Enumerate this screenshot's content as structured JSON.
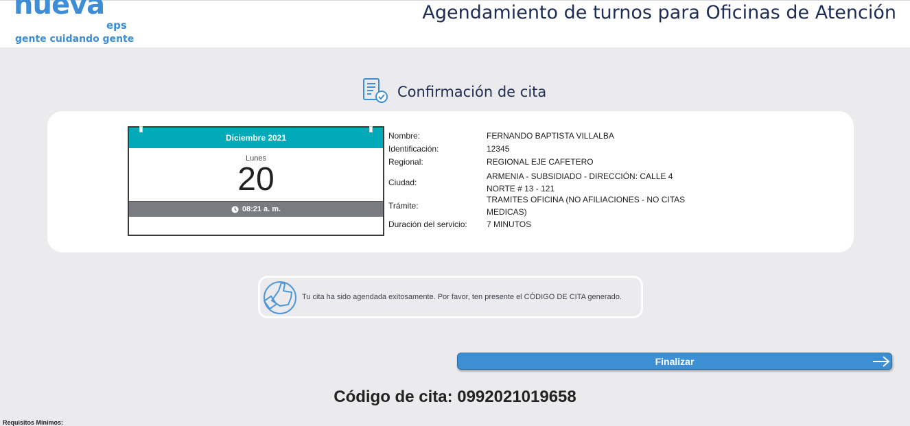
{
  "header": {
    "logo_word": "nueva",
    "logo_sub": "eps",
    "logo_tagline": "gente cuidando gente",
    "title": "Agendamiento de turnos para Oficinas de Atención"
  },
  "section": {
    "title": "Confirmación de cita",
    "icon": "document-check-icon"
  },
  "calendar": {
    "month": "Diciembre 2021",
    "weekday": "Lunes",
    "day": "20",
    "time": "08:21 a. m.",
    "header_color": "#00aab8"
  },
  "details": {
    "name_label": "Nombre:",
    "name_value": "FERNANDO BAPTISTA VILLALBA",
    "id_label": "Identificación:",
    "id_value": "12345",
    "regional_label": "Regional:",
    "regional_value": "REGIONAL EJE CAFETERO",
    "city_label": "Ciudad:",
    "city_value": "ARMENIA - SUBSIDIADO - DIRECCIÓN: CALLE 4 NORTE # 13 - 121",
    "procedure_label": "Trámite:",
    "procedure_value": "TRAMITES OFICINA (NO AFILIACIONES - NO CITAS MEDICAS)",
    "duration_label": "Duración del servicio:",
    "duration_value": "7 MINUTOS"
  },
  "notice": {
    "text": "Tu cita ha sido agendada exitosamente. Por favor, ten presente el CÓDIGO DE CITA generado.",
    "icon": "thumbs-up-icon"
  },
  "actions": {
    "finish_label": "Finalizar",
    "accent": "#3d8fd3"
  },
  "code": {
    "text": "Código de cita: 0992021019658"
  },
  "footer": {
    "requirements": "Requisitos Mínimos:"
  }
}
